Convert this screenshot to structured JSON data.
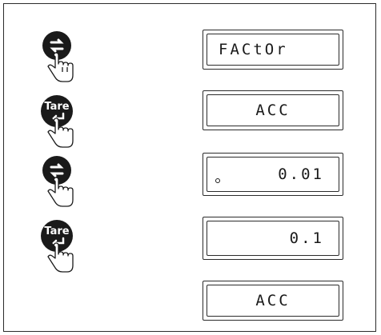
{
  "buttons": [
    {
      "type": "cycle",
      "icon": "cycle-arrows-icon"
    },
    {
      "type": "tare",
      "label": "Tare",
      "icon": "enter-arrow-icon"
    },
    {
      "type": "cycle",
      "icon": "cycle-arrows-icon"
    },
    {
      "type": "tare",
      "label": "Tare",
      "icon": "enter-arrow-icon"
    }
  ],
  "displays": [
    {
      "text": "FACtOr"
    },
    {
      "text": "ACC"
    },
    {
      "text": "0.01",
      "stability_indicator": true
    },
    {
      "text": "0.1"
    },
    {
      "text": "ACC"
    }
  ],
  "colors": {
    "button": "#1a1a1a",
    "line": "#2b2b2b",
    "background": "#ffffff"
  }
}
